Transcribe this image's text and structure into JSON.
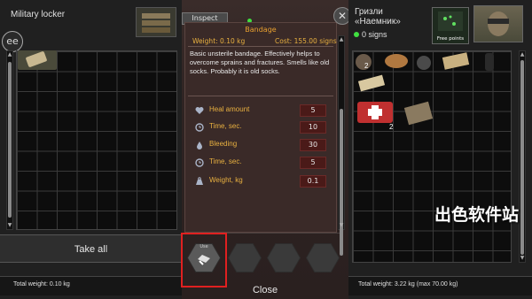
{
  "left_panel": {
    "title": "Military locker",
    "take_all_label": "Take all",
    "total_weight": "Total weight: 0.10 kg"
  },
  "center_panel": {
    "inspect_label": "Inspect",
    "item_name": "Bandage",
    "weight": "Weight: 0.10 kg",
    "cost": "Cost: 155.00 signs",
    "description": "Basic unsterile bandage. Effectively helps to overcome sprains and fractures. Smells like old socks. Probably it is old socks.",
    "stats": [
      {
        "label": "Heal amount",
        "value": "5",
        "icon": "heart-icon"
      },
      {
        "label": "Time, sec.",
        "value": "10",
        "icon": "clock-icon"
      },
      {
        "label": "Bleeding",
        "value": "30",
        "icon": "blood-drop-icon"
      },
      {
        "label": "Time, sec.",
        "value": "5",
        "icon": "clock-icon"
      },
      {
        "label": "Weight, kg",
        "value": "0.1",
        "icon": "weight-icon"
      }
    ],
    "action_label": "Use",
    "close_label": "Close"
  },
  "right_panel": {
    "name": "Гризли",
    "title": "«Наемник»",
    "signs": "0 signs",
    "free_points_label": "Free points",
    "total_weight": "Total weight: 3.22 kg (max 70.00 kg)",
    "item_qtys": [
      "2",
      "2"
    ]
  },
  "watermark": "出色软件站",
  "colors": {
    "accent_orange": "#e8a030",
    "stat_value_bg": "#4a1a18",
    "highlight_red": "#e02020"
  }
}
